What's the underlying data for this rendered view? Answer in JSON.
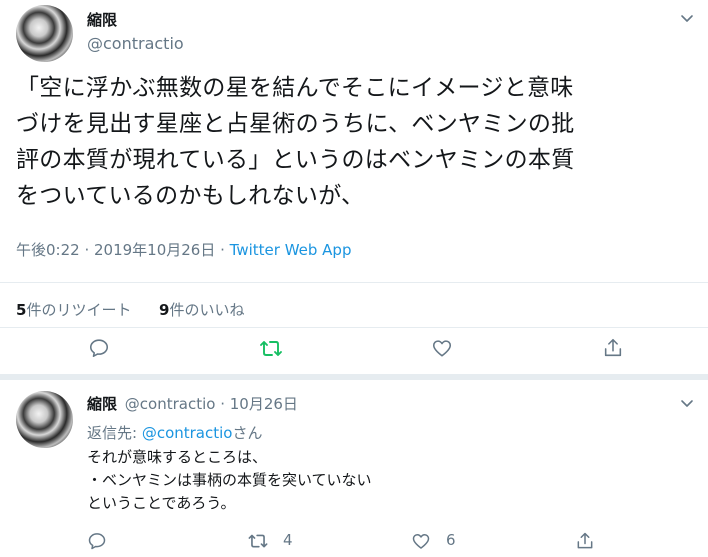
{
  "tweet": {
    "author_name": "縮限",
    "author_handle": "@contractio",
    "text": "「空に浮かぶ無数の星を結んでそこにイメージと意味\nづけを見出す星座と占星術のうちに、ベンヤミンの批\n評の本質が現れている」というのはベンヤミンの本質\nをついているのかもしれないが、",
    "timestamp": "午後0:22 · 2019年10月26日 · ",
    "client": "Twitter Web App",
    "stats": {
      "retweets_count": "5",
      "retweets_label": "件のリツイート",
      "likes_count": "9",
      "likes_label": "件のいいね"
    }
  },
  "reply": {
    "author_name": "縮限",
    "author_handle": "@contractio",
    "date": " · 10月26日",
    "replying_label": "返信先: ",
    "replying_to": "@contractio",
    "replying_suffix": "さん",
    "text": "それが意味するところは、\n・ベンヤミンは事柄の本質を突いていない\nということであろう。",
    "retweet_count": "4",
    "like_count": "6"
  },
  "colors": {
    "accent": "#1b95e0",
    "retweet_green": "#17bf63",
    "icon_gray": "#657786"
  }
}
